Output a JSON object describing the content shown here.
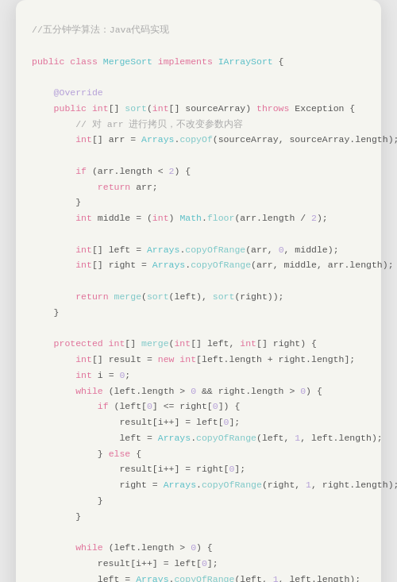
{
  "title": "五分钟学算法：Java代码实现",
  "lines": []
}
